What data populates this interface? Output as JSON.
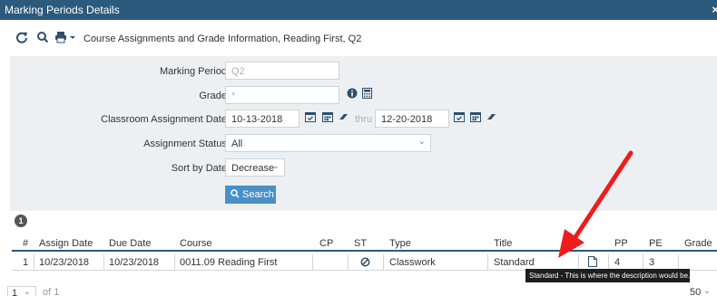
{
  "window": {
    "title": "Marking Periods Details",
    "close_glyph": "×"
  },
  "toolbar": {
    "icons": [
      "refresh-icon",
      "search-icon",
      "print-icon",
      "dropdown-caret-icon"
    ],
    "title": "Course Assignments and Grade Information, Reading First, Q2"
  },
  "filters": {
    "marking_period": {
      "label": "Marking Period:",
      "value": "Q2"
    },
    "grade": {
      "label": "Grade:",
      "value": "*"
    },
    "classroom_assignment_date": {
      "label": "Classroom Assignment Date:",
      "from": "10-13-2018",
      "thru_label": "thru",
      "to": "12-20-2018"
    },
    "assignment_status": {
      "label": "Assignment Status:",
      "value": "All"
    },
    "sort_by_date": {
      "label": "Sort by Date:",
      "value": "Decrease"
    },
    "search_button": "Search"
  },
  "results": {
    "count": "1",
    "columns": [
      "#",
      "Assign Date",
      "Due Date",
      "Course",
      "CP",
      "ST",
      "Type",
      "Title",
      "",
      "PP",
      "PE",
      "Grade"
    ],
    "rows": [
      {
        "num": "1",
        "assign_date": "10/23/2018",
        "due_date": "10/23/2018",
        "course": "0011.09 Reading First",
        "cp": "",
        "st_icon": "no-entry-icon",
        "type": "Classwork",
        "title": "Standard",
        "doc_icon": "document-icon",
        "pp": "4",
        "pe": "3",
        "grade": ""
      }
    ],
    "tooltip": "Standard - This is where the description would be."
  },
  "pager": {
    "page": "1",
    "of_label": "of 1",
    "page_size": "50"
  },
  "colors": {
    "titlebar": "#2c5a7c",
    "panel": "#edf0f2",
    "button": "#4a90c8",
    "annotation_arrow": "#ee1c1c"
  }
}
